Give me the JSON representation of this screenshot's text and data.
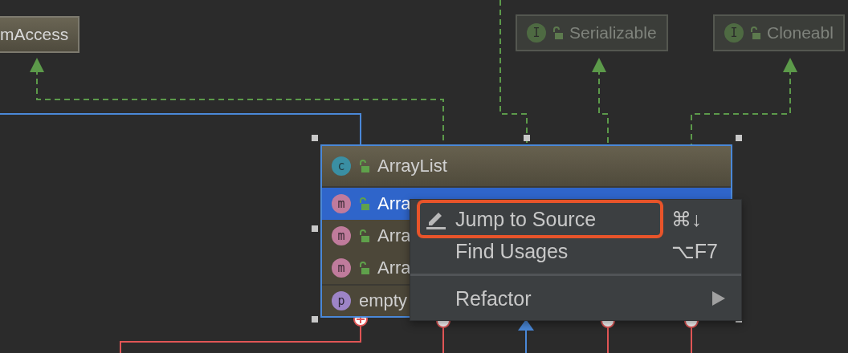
{
  "diagram": {
    "classes": [
      {
        "name": "mAccess",
        "dimmed": false
      },
      {
        "name": "Serializable",
        "dimmed": true,
        "type_icon": "I"
      },
      {
        "name": "Cloneabl",
        "dimmed": true,
        "type_icon": "I"
      }
    ],
    "main_class": {
      "type_icon": "c",
      "name": "ArrayList",
      "members": [
        {
          "kind": "method",
          "icon": "m",
          "name": "Arra",
          "selected": true
        },
        {
          "kind": "method",
          "icon": "m",
          "name": "Arra",
          "selected": false
        },
        {
          "kind": "method",
          "icon": "m",
          "name": "Arra",
          "selected": false
        },
        {
          "kind": "property",
          "icon": "p",
          "name": "empty",
          "selected": false
        }
      ]
    }
  },
  "context_menu": {
    "items": [
      {
        "kind": "item",
        "label": "Jump to Source",
        "shortcut": "⌘↓",
        "has_icon": true,
        "outlined": true
      },
      {
        "kind": "item",
        "label": "Find Usages",
        "shortcut": "⌥F7",
        "has_icon": false,
        "outlined": false
      },
      {
        "kind": "separator"
      },
      {
        "kind": "item",
        "label": "Refactor",
        "submenu": true,
        "has_icon": false,
        "outlined": false
      }
    ]
  }
}
